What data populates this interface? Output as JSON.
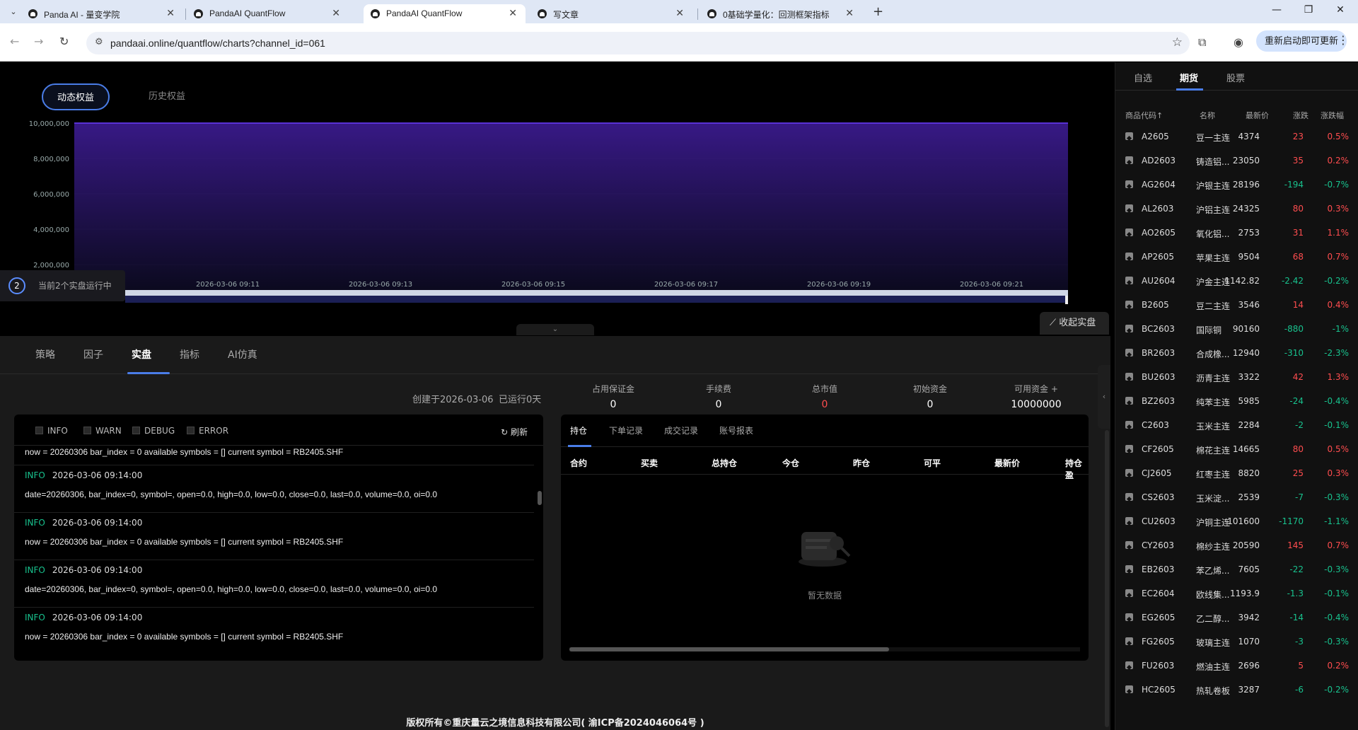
{
  "browser": {
    "tabs": [
      {
        "title": "Panda AI - 量变学院"
      },
      {
        "title": "PandaAI QuantFlow"
      },
      {
        "title": "PandaAI QuantFlow"
      },
      {
        "title": "写文章"
      },
      {
        "title": "0基础学量化：回测框架指标介绍"
      }
    ],
    "url": "pandaai.online/quantflow/charts?channel_id=061",
    "restart_label": "重新启动即可更新"
  },
  "equity_tabs": {
    "dynamic": "动态权益",
    "history": "历史权益"
  },
  "running_badge": {
    "count": "2",
    "text": "当前2个实盘运行中"
  },
  "collapse_live": "收起实盘",
  "chart_data": {
    "type": "area",
    "x": [
      "2026-03-06 09:10",
      "2026-03-06 09:11",
      "2026-03-06 09:12",
      "2026-03-06 09:13",
      "2026-03-06 09:14",
      "2026-03-06 09:15",
      "2026-03-06 09:16",
      "2026-03-06 09:17",
      "2026-03-06 09:18",
      "2026-03-06 09:19",
      "2026-03-06 09:20",
      "2026-03-06 09:21",
      "2026-03-06 09:22"
    ],
    "values": [
      10000000,
      10000000,
      10000000,
      10000000,
      10000000,
      10000000,
      10000000,
      10000000,
      10000000,
      10000000,
      10000000,
      10000000,
      10000000
    ],
    "x_ticks": [
      "2026-03-06 09:11",
      "2026-03-06 09:13",
      "2026-03-06 09:15",
      "2026-03-06 09:17",
      "2026-03-06 09:19",
      "2026-03-06 09:21"
    ],
    "y_ticks": [
      "10,000,000",
      "8,000,000",
      "6,000,000",
      "4,000,000",
      "2,000,000"
    ],
    "ylim": [
      0,
      10000000
    ],
    "grid": true
  },
  "main_tabs": [
    "策略",
    "因子",
    "实盘",
    "指标",
    "AI仿真"
  ],
  "meta": {
    "created": "创建于2026-03-06",
    "running": "已运行0天"
  },
  "stats": [
    {
      "label": "占用保证金",
      "value": "0"
    },
    {
      "label": "手续费",
      "value": "0"
    },
    {
      "label": "总市值",
      "value": "0"
    },
    {
      "label": "初始资金",
      "value": "0"
    },
    {
      "label": "可用资金",
      "value": "10000000"
    }
  ],
  "colors": {
    "accent": "#4a7de8",
    "up": "#ff4d4f",
    "down": "#18c28e",
    "info": "#18c28e"
  },
  "log": {
    "filters": [
      "INFO",
      "WARN",
      "DEBUG",
      "ERROR"
    ],
    "refresh": "刷新",
    "top_msg": "now = 20260306 bar_index = 0 available symbols = [] current symbol = RB2405.SHF",
    "entries": [
      {
        "level": "INFO",
        "time": "2026-03-06 09:14:00",
        "msg": "date=20260306, bar_index=0, symbol=, open=0.0, high=0.0, low=0.0, close=0.0, last=0.0, volume=0.0, oi=0.0"
      },
      {
        "level": "INFO",
        "time": "2026-03-06 09:14:00",
        "msg": "now = 20260306 bar_index = 0 available symbols = [] current symbol = RB2405.SHF"
      },
      {
        "level": "INFO",
        "time": "2026-03-06 09:14:00",
        "msg": "date=20260306, bar_index=0, symbol=, open=0.0, high=0.0, low=0.0, close=0.0, last=0.0, volume=0.0, oi=0.0"
      },
      {
        "level": "INFO",
        "time": "2026-03-06 09:14:00",
        "msg": "now = 20260306 bar_index = 0 available symbols = [] current symbol = RB2405.SHF"
      }
    ]
  },
  "positions": {
    "tabs": [
      "持仓",
      "下单记录",
      "成交记录",
      "账号报表"
    ],
    "columns": [
      "合约",
      "买卖",
      "总持仓",
      "今仓",
      "昨仓",
      "可平",
      "最新价",
      "持仓盈"
    ],
    "empty": "暂无数据"
  },
  "footer": "版权所有©重庆量云之境信息科技有限公司( 渝ICP备2024046064号 )",
  "market": {
    "tabs": [
      "自选",
      "期货",
      "股票"
    ],
    "headers": [
      "商品代码↑",
      "名称",
      "最新价",
      "涨跌",
      "涨跌幅"
    ],
    "rows": [
      {
        "code": "A2605",
        "name": "豆一主连",
        "price": "4374",
        "chg": "23",
        "pct": "0.5%",
        "dir": "up"
      },
      {
        "code": "AD2603",
        "name": "铸造铝...",
        "price": "23050",
        "chg": "35",
        "pct": "0.2%",
        "dir": "up"
      },
      {
        "code": "AG2604",
        "name": "沪银主连",
        "price": "28196",
        "chg": "-194",
        "pct": "-0.7%",
        "dir": "down"
      },
      {
        "code": "AL2603",
        "name": "沪铝主连",
        "price": "24325",
        "chg": "80",
        "pct": "0.3%",
        "dir": "up"
      },
      {
        "code": "AO2605",
        "name": "氧化铝...",
        "price": "2753",
        "chg": "31",
        "pct": "1.1%",
        "dir": "up"
      },
      {
        "code": "AP2605",
        "name": "苹果主连",
        "price": "9504",
        "chg": "68",
        "pct": "0.7%",
        "dir": "up"
      },
      {
        "code": "AU2604",
        "name": "沪金主连",
        "price": "1142.82",
        "chg": "-2.42",
        "pct": "-0.2%",
        "dir": "down"
      },
      {
        "code": "B2605",
        "name": "豆二主连",
        "price": "3546",
        "chg": "14",
        "pct": "0.4%",
        "dir": "up"
      },
      {
        "code": "BC2603",
        "name": "国际铜",
        "price": "90160",
        "chg": "-880",
        "pct": "-1%",
        "dir": "down"
      },
      {
        "code": "BR2603",
        "name": "合成橡...",
        "price": "12940",
        "chg": "-310",
        "pct": "-2.3%",
        "dir": "down"
      },
      {
        "code": "BU2603",
        "name": "沥青主连",
        "price": "3322",
        "chg": "42",
        "pct": "1.3%",
        "dir": "up"
      },
      {
        "code": "BZ2603",
        "name": "纯苯主连",
        "price": "5985",
        "chg": "-24",
        "pct": "-0.4%",
        "dir": "down"
      },
      {
        "code": "C2603",
        "name": "玉米主连",
        "price": "2284",
        "chg": "-2",
        "pct": "-0.1%",
        "dir": "down"
      },
      {
        "code": "CF2605",
        "name": "棉花主连",
        "price": "14665",
        "chg": "80",
        "pct": "0.5%",
        "dir": "up"
      },
      {
        "code": "CJ2605",
        "name": "红枣主连",
        "price": "8820",
        "chg": "25",
        "pct": "0.3%",
        "dir": "up"
      },
      {
        "code": "CS2603",
        "name": "玉米淀...",
        "price": "2539",
        "chg": "-7",
        "pct": "-0.3%",
        "dir": "down"
      },
      {
        "code": "CU2603",
        "name": "沪铜主连",
        "price": "101600",
        "chg": "-1170",
        "pct": "-1.1%",
        "dir": "down"
      },
      {
        "code": "CY2603",
        "name": "棉纱主连",
        "price": "20590",
        "chg": "145",
        "pct": "0.7%",
        "dir": "up"
      },
      {
        "code": "EB2603",
        "name": "苯乙烯...",
        "price": "7605",
        "chg": "-22",
        "pct": "-0.3%",
        "dir": "down"
      },
      {
        "code": "EC2604",
        "name": "欧线集...",
        "price": "1193.9",
        "chg": "-1.3",
        "pct": "-0.1%",
        "dir": "down"
      },
      {
        "code": "EG2605",
        "name": "乙二醇...",
        "price": "3942",
        "chg": "-14",
        "pct": "-0.4%",
        "dir": "down"
      },
      {
        "code": "FG2605",
        "name": "玻璃主连",
        "price": "1070",
        "chg": "-3",
        "pct": "-0.3%",
        "dir": "down"
      },
      {
        "code": "FU2603",
        "name": "燃油主连",
        "price": "2696",
        "chg": "5",
        "pct": "0.2%",
        "dir": "up"
      },
      {
        "code": "HC2605",
        "name": "热轧卷板",
        "price": "3287",
        "chg": "-6",
        "pct": "-0.2%",
        "dir": "down"
      }
    ]
  }
}
